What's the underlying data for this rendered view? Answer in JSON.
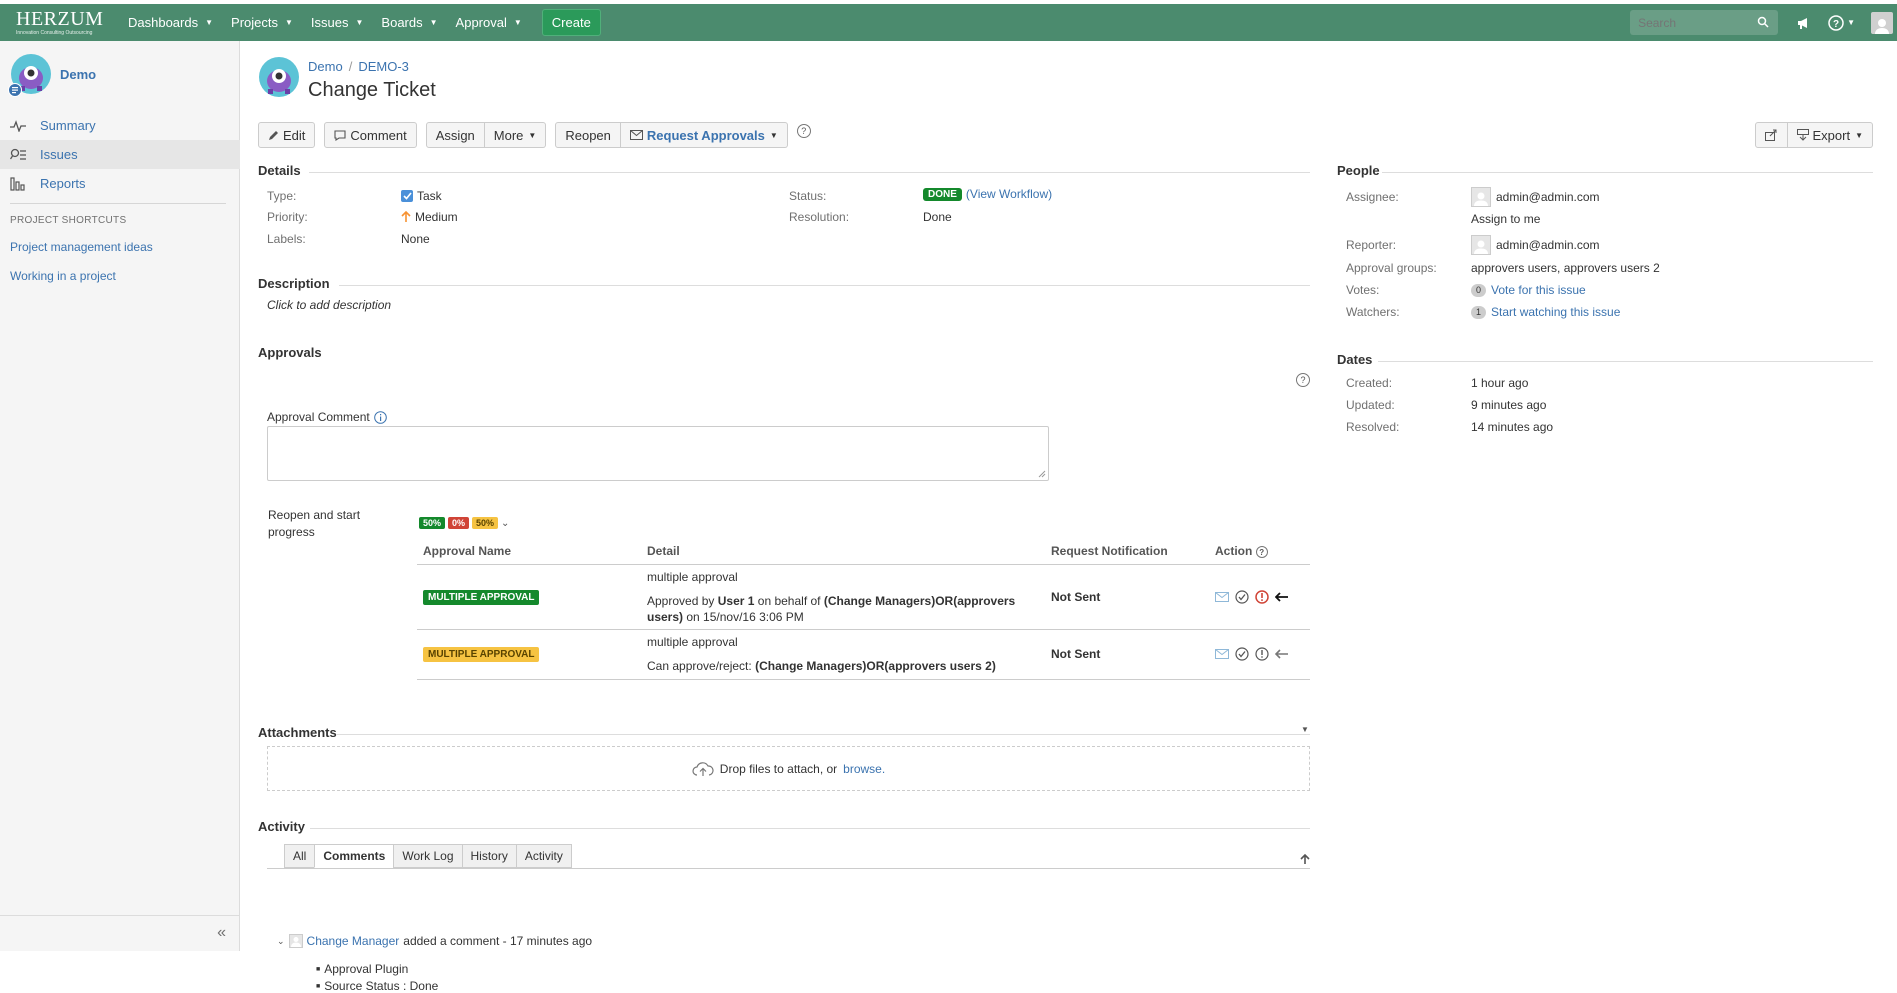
{
  "nav": {
    "logo_word": "HERZUM",
    "logo_tag": "Innovation Consulting Outsourcing",
    "items": [
      {
        "label": "Dashboards"
      },
      {
        "label": "Projects"
      },
      {
        "label": "Issues"
      },
      {
        "label": "Boards"
      },
      {
        "label": "Approval"
      }
    ],
    "create_label": "Create",
    "search_placeholder": "Search",
    "bg_color": "#4b8b6e"
  },
  "sidebar": {
    "project_name": "Demo",
    "items": [
      {
        "label": "Summary",
        "icon": "pulse-icon"
      },
      {
        "label": "Issues",
        "icon": "issues-icon"
      },
      {
        "label": "Reports",
        "icon": "reports-icon"
      }
    ],
    "shortcuts_title": "PROJECT SHORTCUTS",
    "shortcuts": [
      {
        "label": "Project management ideas"
      },
      {
        "label": "Working in a project"
      }
    ],
    "collapse_glyph": "«"
  },
  "issue": {
    "breadcrumb_project": "Demo",
    "breadcrumb_sep": "/",
    "breadcrumb_key": "DEMO-3",
    "title": "Change Ticket"
  },
  "toolbar": {
    "edit": "Edit",
    "comment": "Comment",
    "assign": "Assign",
    "more": "More",
    "reopen": "Reopen",
    "request_approvals": "Request Approvals",
    "help": "?",
    "export": "Export"
  },
  "details": {
    "title": "Details",
    "type_label": "Type:",
    "type_value": "Task",
    "priority_label": "Priority:",
    "priority_value": "Medium",
    "labels_label": "Labels:",
    "labels_value": "None",
    "status_label": "Status:",
    "status_value": "DONE",
    "view_workflow": "(View Workflow)",
    "resolution_label": "Resolution:",
    "resolution_value": "Done"
  },
  "description": {
    "title": "Description",
    "placeholder": "Click to add description"
  },
  "approvals": {
    "title": "Approvals",
    "comment_label": "Approval Comment",
    "transition_label": "Reopen and start progress",
    "progress": [
      {
        "label": "50%",
        "color": "#14892c"
      },
      {
        "label": "0%",
        "color": "#d04437"
      },
      {
        "label": "50%",
        "color": "#f6c342"
      }
    ],
    "headers": [
      "Approval Name",
      "Detail",
      "Request Notification",
      "Action"
    ],
    "rows": [
      {
        "name": "MULTIPLE APPROVAL",
        "color": "#14892c",
        "text_color": "#ffffff",
        "detail_title": "multiple approval",
        "detail_prefix": "Approved by",
        "detail_user": "User 1",
        "detail_mid": "on behalf of",
        "detail_groups": "(Change Managers)OR(approvers users)",
        "detail_suffix": "on 15/nov/16 3:06 PM",
        "notification": "Not Sent"
      },
      {
        "name": "MULTIPLE APPROVAL",
        "color": "#f6c342",
        "text_color": "#594300",
        "detail_title": "multiple approval",
        "detail_prefix": "Can approve/reject:",
        "detail_groups": "(Change Managers)OR(approvers users 2)",
        "notification": "Not Sent"
      }
    ]
  },
  "attachments": {
    "title": "Attachments",
    "drop_text": "Drop files to attach, or",
    "browse": "browse."
  },
  "activity": {
    "title": "Activity",
    "tabs": [
      "All",
      "Comments",
      "Work Log",
      "History",
      "Activity"
    ],
    "active_tab": "Comments",
    "comment_author": "Change Manager",
    "comment_meta": "added a comment - 17 minutes ago",
    "bullets": [
      "Approval Plugin",
      "Source Status : Done"
    ]
  },
  "people": {
    "title": "People",
    "assignee_label": "Assignee:",
    "assignee_value": "admin@admin.com",
    "assign_to_me": "Assign to me",
    "reporter_label": "Reporter:",
    "reporter_value": "admin@admin.com",
    "groups_label": "Approval groups:",
    "groups_value": "approvers users, approvers users 2",
    "votes_label": "Votes:",
    "votes_count": "0",
    "votes_text": "Vote for this issue",
    "watchers_label": "Watchers:",
    "watchers_count": "1",
    "watchers_text": "Start watching this issue"
  },
  "dates": {
    "title": "Dates",
    "created_label": "Created:",
    "created_value": "1 hour ago",
    "updated_label": "Updated:",
    "updated_value": "9 minutes ago",
    "resolved_label": "Resolved:",
    "resolved_value": "14 minutes ago"
  }
}
